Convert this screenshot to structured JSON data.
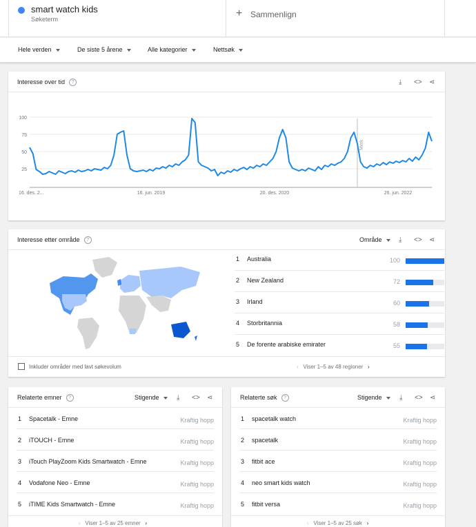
{
  "search_term": {
    "name": "smart watch kids",
    "subtitle": "Søketerm",
    "color": "#4285f4"
  },
  "compare": {
    "icon": "plus-icon",
    "label": "Sammenlign"
  },
  "filters": [
    "Hele verden",
    "De siste 5 årene",
    "Alle kategorier",
    "Nettsøk"
  ],
  "interest_over_time": {
    "title": "Interesse over tid",
    "note_label": "Merk",
    "chart_data": {
      "type": "line",
      "title": "",
      "xlabel": "",
      "ylabel": "",
      "ylim": [
        0,
        100
      ],
      "y_ticks": [
        "100",
        "75",
        "50",
        "25"
      ],
      "x_ticks": [
        "16. des. 2...",
        "16. jun. 2019",
        "20. des. 2020",
        "26. jun. 2022"
      ],
      "grid": true,
      "series": [
        {
          "values": [
            56,
            47,
            24,
            21,
            17,
            18,
            21,
            19,
            17,
            22,
            20,
            18,
            21,
            22,
            20,
            23,
            21,
            22,
            24,
            22,
            25,
            24,
            23,
            27,
            25,
            30,
            45,
            75,
            78,
            80,
            45,
            25,
            22,
            21,
            22,
            23,
            21,
            24,
            22,
            26,
            25,
            28,
            26,
            30,
            28,
            32,
            30,
            35,
            38,
            45,
            98,
            92,
            35,
            30,
            28,
            26,
            22,
            24,
            15,
            20,
            18,
            22,
            20,
            24,
            22,
            25,
            27,
            24,
            28,
            26,
            30,
            28,
            32,
            30,
            35,
            40,
            50,
            70,
            82,
            70,
            35,
            26,
            24,
            22,
            24,
            22,
            26,
            24,
            22,
            28,
            24,
            30,
            28,
            32,
            30,
            33,
            35,
            40,
            50,
            70,
            78,
            62,
            35,
            28,
            26,
            30,
            28,
            32,
            30,
            34,
            31,
            35,
            33,
            36,
            34,
            37,
            35,
            40,
            36,
            42,
            38,
            45,
            55,
            78,
            65
          ]
        }
      ]
    }
  },
  "interest_by_region": {
    "title": "Interesse etter område",
    "dropdown_label": "Område",
    "checkbox_label": "Inkluder områder med lavt søkevolum",
    "pager": "Viser 1–5 av 48 regioner",
    "rows": [
      {
        "rank": "1",
        "name": "Australia",
        "value": "100",
        "fraction": 1.0
      },
      {
        "rank": "2",
        "name": "New Zealand",
        "value": "72",
        "fraction": 0.72
      },
      {
        "rank": "3",
        "name": "Irland",
        "value": "60",
        "fraction": 0.6
      },
      {
        "rank": "4",
        "name": "Storbritannia",
        "value": "58",
        "fraction": 0.58
      },
      {
        "rank": "5",
        "name": "De forente arabiske emirater",
        "value": "55",
        "fraction": 0.55
      }
    ]
  },
  "related_topics": {
    "title": "Relaterte emner",
    "dropdown_label": "Stigende",
    "pager": "Viser 1–5 av 25 emner",
    "rows": [
      {
        "rank": "1",
        "name": "Spacetalk - Emne",
        "tag": "Kraftig hopp"
      },
      {
        "rank": "2",
        "name": "iTOUCH - Emne",
        "tag": "Kraftig hopp"
      },
      {
        "rank": "3",
        "name": "iTouch PlayZoom Kids Smartwatch - Emne",
        "tag": "Kraftig hopp"
      },
      {
        "rank": "4",
        "name": "Vodafone Neo - Emne",
        "tag": "Kraftig hopp"
      },
      {
        "rank": "5",
        "name": "iTIME Kids Smartwatch - Emne",
        "tag": "Kraftig hopp"
      }
    ]
  },
  "related_queries": {
    "title": "Relaterte søk",
    "dropdown_label": "Stigende",
    "pager": "Viser 1–5 av 25 søk",
    "rows": [
      {
        "rank": "1",
        "name": "spacetalk watch",
        "tag": "Kraftig hopp"
      },
      {
        "rank": "2",
        "name": "spacetalk",
        "tag": "Kraftig hopp"
      },
      {
        "rank": "3",
        "name": "fitbit ace",
        "tag": "Kraftig hopp"
      },
      {
        "rank": "4",
        "name": "neo smart kids watch",
        "tag": "Kraftig hopp"
      },
      {
        "rank": "5",
        "name": "fitbit versa",
        "tag": "Kraftig hopp"
      }
    ]
  },
  "colors": {
    "accent": "#1a73e8",
    "line": "#1e88e5",
    "map_dark": "#1a73e8",
    "map_mid": "#a8c7fa",
    "map_none": "#d5d5d5"
  }
}
